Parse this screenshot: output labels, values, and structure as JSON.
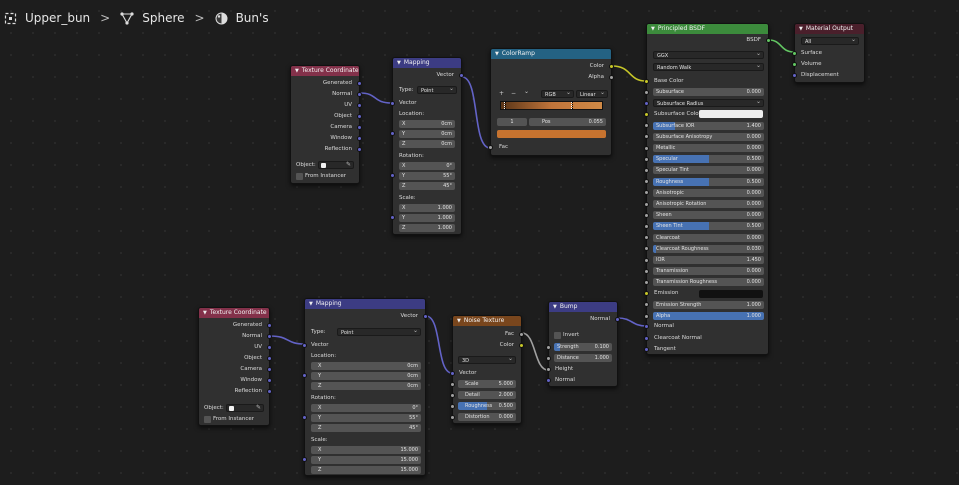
{
  "breadcrumb": {
    "items": [
      "Upper_bun",
      "Sphere",
      "Bun's"
    ]
  },
  "nodes": {
    "texcoord1": {
      "title": "Texture Coordinate",
      "outputs": [
        "Generated",
        "Normal",
        "UV",
        "Object",
        "Camera",
        "Window",
        "Reflection"
      ],
      "object_label": "Object:",
      "from_instancer": "From Instancer"
    },
    "mapping1": {
      "title": "Mapping",
      "out": "Vector",
      "type_label": "Type:",
      "type_value": "Point",
      "in_vector": "Vector",
      "location_label": "Location:",
      "rotation_label": "Rotation:",
      "scale_label": "Scale:",
      "location": [
        {
          "k": "X",
          "v": "0cm"
        },
        {
          "k": "Y",
          "v": "0cm"
        },
        {
          "k": "Z",
          "v": "0cm"
        }
      ],
      "rotation": [
        {
          "k": "X",
          "v": "0°"
        },
        {
          "k": "Y",
          "v": "55°"
        },
        {
          "k": "Z",
          "v": "45°"
        }
      ],
      "scale": [
        {
          "k": "X",
          "v": "1.000"
        },
        {
          "k": "Y",
          "v": "1.000"
        },
        {
          "k": "Z",
          "v": "1.000"
        }
      ]
    },
    "colorramp": {
      "title": "ColorRamp",
      "out_color": "Color",
      "out_alpha": "Alpha",
      "add": "+",
      "remove": "−",
      "menu": "⌄",
      "mode": "RGB",
      "interp": "Linear",
      "index": "1",
      "pos_label": "Pos",
      "pos_value": "0.055",
      "fac": "Fac"
    },
    "bsdf": {
      "title": "Principled BSDF",
      "out": "BSDF",
      "distribution": "GGX",
      "subsurface_method": "Random Walk",
      "base_color": "Base Color",
      "rows": [
        {
          "label": "Subsurface",
          "value": "0.000",
          "fill": 0
        },
        {
          "label": "Subsurface Radius",
          "dropdown": true
        },
        {
          "label": "Subsurface Colo",
          "swatch": "#eeeeee"
        },
        {
          "label": "Subsurface IOR",
          "value": "1.400",
          "fill": 0.2
        },
        {
          "label": "Subsurface Anisotropy",
          "value": "0.000",
          "fill": 0
        },
        {
          "label": "Metallic",
          "value": "0.000",
          "fill": 0
        },
        {
          "label": "Specular",
          "value": "0.500",
          "fill": 0.5
        },
        {
          "label": "Specular Tint",
          "value": "0.000",
          "fill": 0
        },
        {
          "label": "Roughness",
          "value": "0.500",
          "fill": 0.5
        },
        {
          "label": "Anisotropic",
          "value": "0.000",
          "fill": 0
        },
        {
          "label": "Anisotropic Rotation",
          "value": "0.000",
          "fill": 0
        },
        {
          "label": "Sheen",
          "value": "0.000",
          "fill": 0
        },
        {
          "label": "Sheen Tint",
          "value": "0.500",
          "fill": 0.5
        },
        {
          "label": "Clearcoat",
          "value": "0.000",
          "fill": 0
        },
        {
          "label": "Clearcoat Roughness",
          "value": "0.030",
          "fill": 0.03
        },
        {
          "label": "IOR",
          "value": "1.450",
          "fill": 0
        },
        {
          "label": "Transmission",
          "value": "0.000",
          "fill": 0
        },
        {
          "label": "Transmission Roughness",
          "value": "0.000",
          "fill": 0
        },
        {
          "label": "Emission",
          "swatch": "#111111"
        },
        {
          "label": "Emission Strength",
          "value": "1.000",
          "fill": 0
        },
        {
          "label": "Alpha",
          "value": "1.000",
          "fill": 1
        }
      ],
      "normal": "Normal",
      "clearcoat_normal": "Clearcoat Normal",
      "tangent": "Tangent"
    },
    "matout": {
      "title": "Material Output",
      "target": "All",
      "inputs": [
        "Surface",
        "Volume",
        "Displacement"
      ]
    },
    "texcoord2": {
      "title": "Texture Coordinate",
      "outputs": [
        "Generated",
        "Normal",
        "UV",
        "Object",
        "Camera",
        "Window",
        "Reflection"
      ],
      "object_label": "Object:",
      "from_instancer": "From Instancer"
    },
    "mapping2": {
      "title": "Mapping",
      "out": "Vector",
      "type_label": "Type:",
      "type_value": "Point",
      "in_vector": "Vector",
      "location_label": "Location:",
      "rotation_label": "Rotation:",
      "scale_label": "Scale:",
      "location": [
        {
          "k": "X",
          "v": "0cm"
        },
        {
          "k": "Y",
          "v": "0cm"
        },
        {
          "k": "Z",
          "v": "0cm"
        }
      ],
      "rotation": [
        {
          "k": "X",
          "v": "0°"
        },
        {
          "k": "Y",
          "v": "55°"
        },
        {
          "k": "Z",
          "v": "45°"
        }
      ],
      "scale": [
        {
          "k": "X",
          "v": "15.000"
        },
        {
          "k": "Y",
          "v": "15.000"
        },
        {
          "k": "Z",
          "v": "15.000"
        }
      ]
    },
    "noise": {
      "title": "Noise Texture",
      "out_fac": "Fac",
      "out_color": "Color",
      "dimensions": "3D",
      "in_vector": "Vector",
      "fields": [
        {
          "label": "Scale",
          "value": "5.000",
          "fill": 0
        },
        {
          "label": "Detail",
          "value": "2.000",
          "fill": 0
        },
        {
          "label": "Roughness",
          "value": "0.500",
          "fill": 0.5
        },
        {
          "label": "Distortion",
          "value": "0.000",
          "fill": 0
        }
      ]
    },
    "bump": {
      "title": "Bump",
      "out": "Normal",
      "invert": "Invert",
      "strength_label": "Strength",
      "strength": "0.100",
      "strength_fill": 0.1,
      "distance_label": "Distance",
      "distance": "1.000",
      "height": "Height",
      "normal": "Normal"
    }
  },
  "colors": {
    "accent": "#4772b3",
    "input_header": "#83314a",
    "vector_header": "#3c3c83",
    "converter_header": "#246283",
    "texture_header": "#79461d",
    "shader_header": "#3c8b3c",
    "output_header": "#4a1f2b"
  }
}
